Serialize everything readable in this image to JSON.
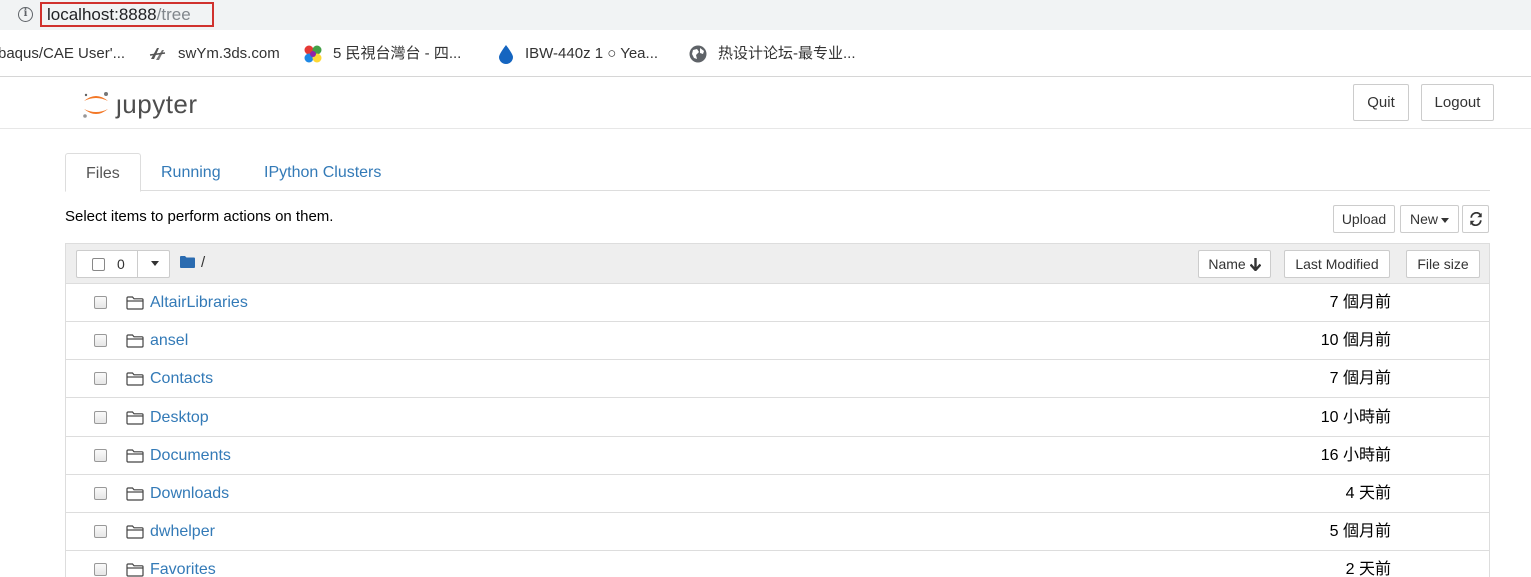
{
  "browser": {
    "url_host": "localhost:8888",
    "url_path": "/tree",
    "bookmarks": [
      {
        "label": "baqus/CAE User'...",
        "icon": "none"
      },
      {
        "label": "swYm.3ds.com",
        "icon": "3ds-logo-icon"
      },
      {
        "label": "5 民視台灣台 - 四...",
        "icon": "colorful-dots-icon"
      },
      {
        "label": "IBW-440z 1 ○ Yea...",
        "icon": "water-drop-icon"
      },
      {
        "label": "热设计论坛-最专业...",
        "icon": "globe-icon"
      }
    ]
  },
  "header": {
    "logo_text": "Jupyter",
    "quit_label": "Quit",
    "logout_label": "Logout"
  },
  "tabs": [
    {
      "label": "Files",
      "active": true
    },
    {
      "label": "Running",
      "active": false
    },
    {
      "label": "IPython Clusters",
      "active": false
    }
  ],
  "toolbar": {
    "hint": "Select items to perform actions on them.",
    "upload_label": "Upload",
    "new_label": "New",
    "refresh_icon": "refresh-icon"
  },
  "list_header": {
    "selected_count": "0",
    "breadcrumb": "/",
    "name_label": "Name",
    "last_modified_label": "Last Modified",
    "file_size_label": "File size"
  },
  "files": [
    {
      "name": "AltairLibraries",
      "modified": "7 個月前"
    },
    {
      "name": "ansel",
      "modified": "10 個月前"
    },
    {
      "name": "Contacts",
      "modified": "7 個月前"
    },
    {
      "name": "Desktop",
      "modified": "10 小時前"
    },
    {
      "name": "Documents",
      "modified": "16 小時前"
    },
    {
      "name": "Downloads",
      "modified": "4 天前"
    },
    {
      "name": "dwhelper",
      "modified": "5 個月前"
    },
    {
      "name": "Favorites",
      "modified": "2 天前"
    }
  ],
  "colors": {
    "link": "#337ab7",
    "jupyter_orange": "#f37726",
    "url_highlight": "#d0312d",
    "folder_blue": "#2a6bb0"
  }
}
